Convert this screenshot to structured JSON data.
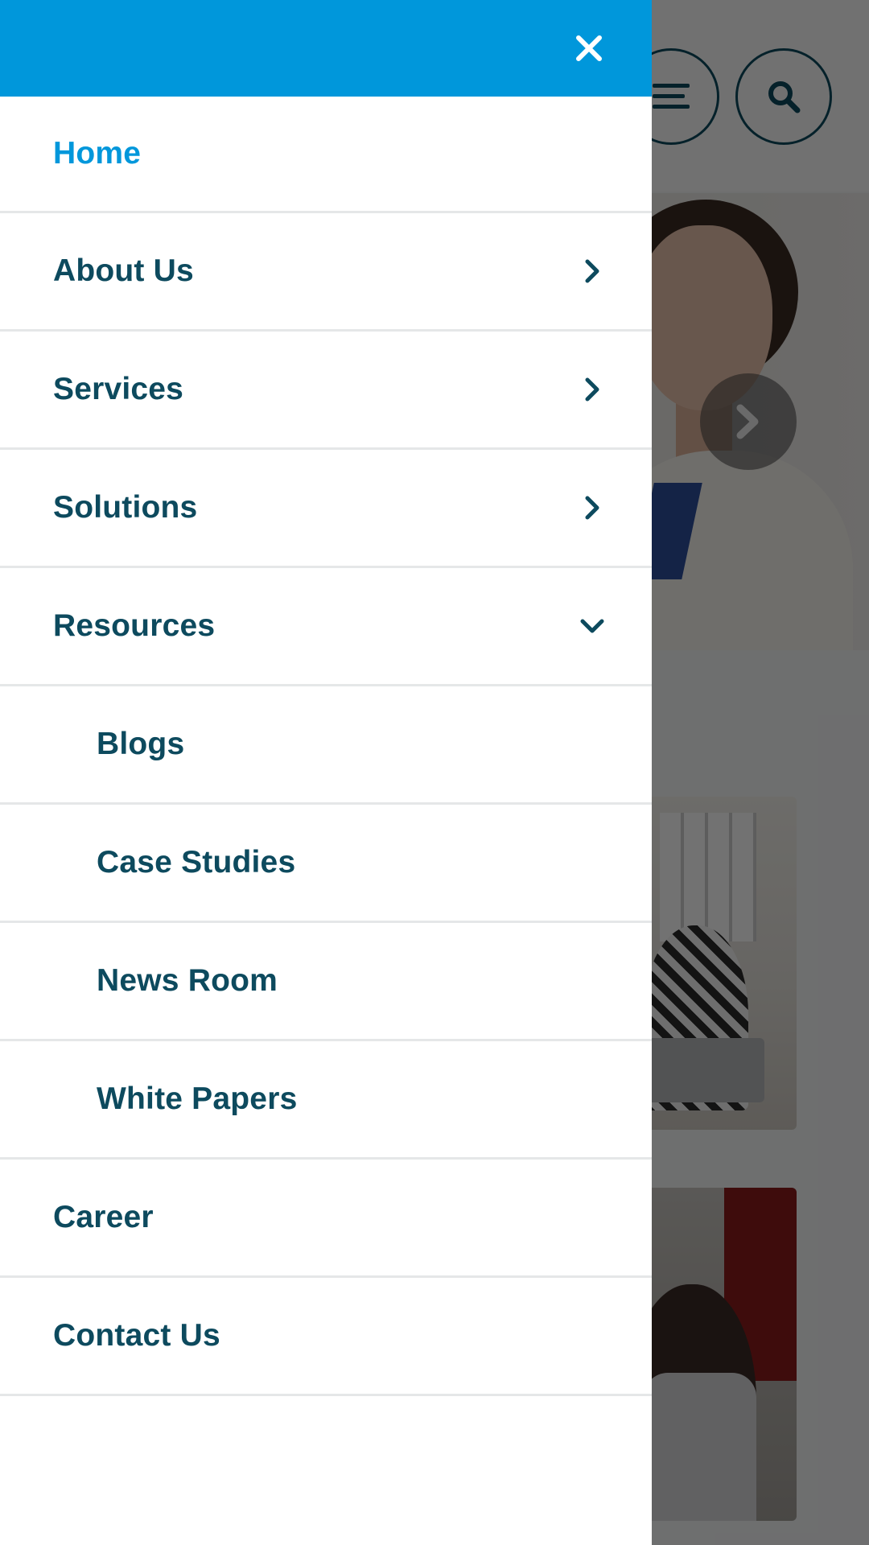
{
  "drawer": {
    "menu": [
      {
        "label": "Home",
        "active": true,
        "level": 0,
        "chevron": "none"
      },
      {
        "label": "About Us",
        "level": 0,
        "chevron": "right"
      },
      {
        "label": "Services",
        "level": 0,
        "chevron": "right"
      },
      {
        "label": "Solutions",
        "level": 0,
        "chevron": "right"
      },
      {
        "label": "Resources",
        "level": 0,
        "chevron": "down"
      },
      {
        "label": "Blogs",
        "level": 1,
        "chevron": "none"
      },
      {
        "label": "Case Studies",
        "level": 1,
        "chevron": "none"
      },
      {
        "label": "News Room",
        "level": 1,
        "chevron": "none"
      },
      {
        "label": "White Papers",
        "level": 1,
        "chevron": "none"
      },
      {
        "label": "Career",
        "level": 0,
        "chevron": "none"
      },
      {
        "label": "Contact Us",
        "level": 0,
        "chevron": "none"
      }
    ],
    "icons": {
      "close": "close-icon",
      "expand": "chevron-right-icon",
      "collapse": "chevron-down-icon"
    }
  },
  "background": {
    "icons": {
      "menu": "hamburger-menu-icon",
      "search": "search-icon",
      "carousel_next": "chevron-right-icon"
    },
    "overlay_dimmed": true
  },
  "colors": {
    "header_blue": "#0097db",
    "nav_text": "#0d4a5e",
    "active_text": "#0097db",
    "divider": "#e5e7e8"
  }
}
